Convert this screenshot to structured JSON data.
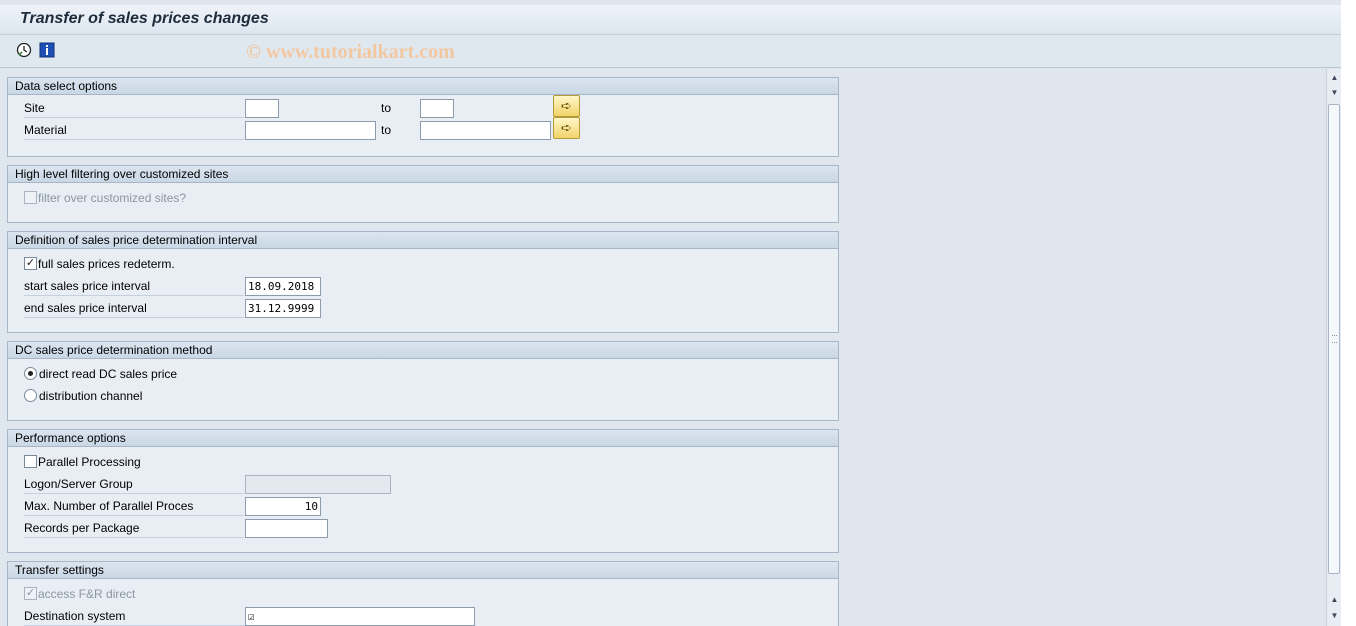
{
  "window": {
    "title": "Transfer of sales prices changes",
    "watermark": "© www.tutorialkart.com"
  },
  "toolbar": {
    "icons": [
      "execute-clock-icon",
      "info-icon"
    ]
  },
  "groups": {
    "data_select": {
      "header": "Data select options",
      "site_label": "Site",
      "site_from": "",
      "site_to_label": "to",
      "site_to": "",
      "material_label": "Material",
      "material_from": "",
      "material_to_label": "to",
      "material_to": ""
    },
    "high_level": {
      "header": "High level filtering over customized sites",
      "filter_label": "filter over customized sites?",
      "filter_checked": false
    },
    "definition": {
      "header": "Definition of sales price determination interval",
      "full_redeterm_label": "full sales prices redeterm.",
      "full_redeterm_checked": true,
      "start_label": "start sales price interval",
      "start_value": "18.09.2018",
      "end_label": "end sales price interval",
      "end_value": "31.12.9999"
    },
    "dc_method": {
      "header": "DC sales price determination method",
      "option_direct": "direct read DC sales price",
      "option_channel": "distribution channel",
      "selected": "direct"
    },
    "performance": {
      "header": "Performance options",
      "parallel_label": "Parallel Processing",
      "parallel_checked": false,
      "logon_label": "Logon/Server Group",
      "logon_value": "",
      "max_label": "Max. Number of Parallel Proces",
      "max_value": "10",
      "records_label": "Records per Package",
      "records_value": ""
    },
    "transfer": {
      "header": "Transfer settings",
      "access_label": "access F&R direct",
      "access_checked": true,
      "destination_label": "Destination system",
      "destination_value": "☑"
    }
  },
  "colors": {
    "background": "#dfe6ee",
    "group_header": "#c9d7e5",
    "arrow_button": "#f1d36b",
    "watermark": "#f3c7a0"
  }
}
